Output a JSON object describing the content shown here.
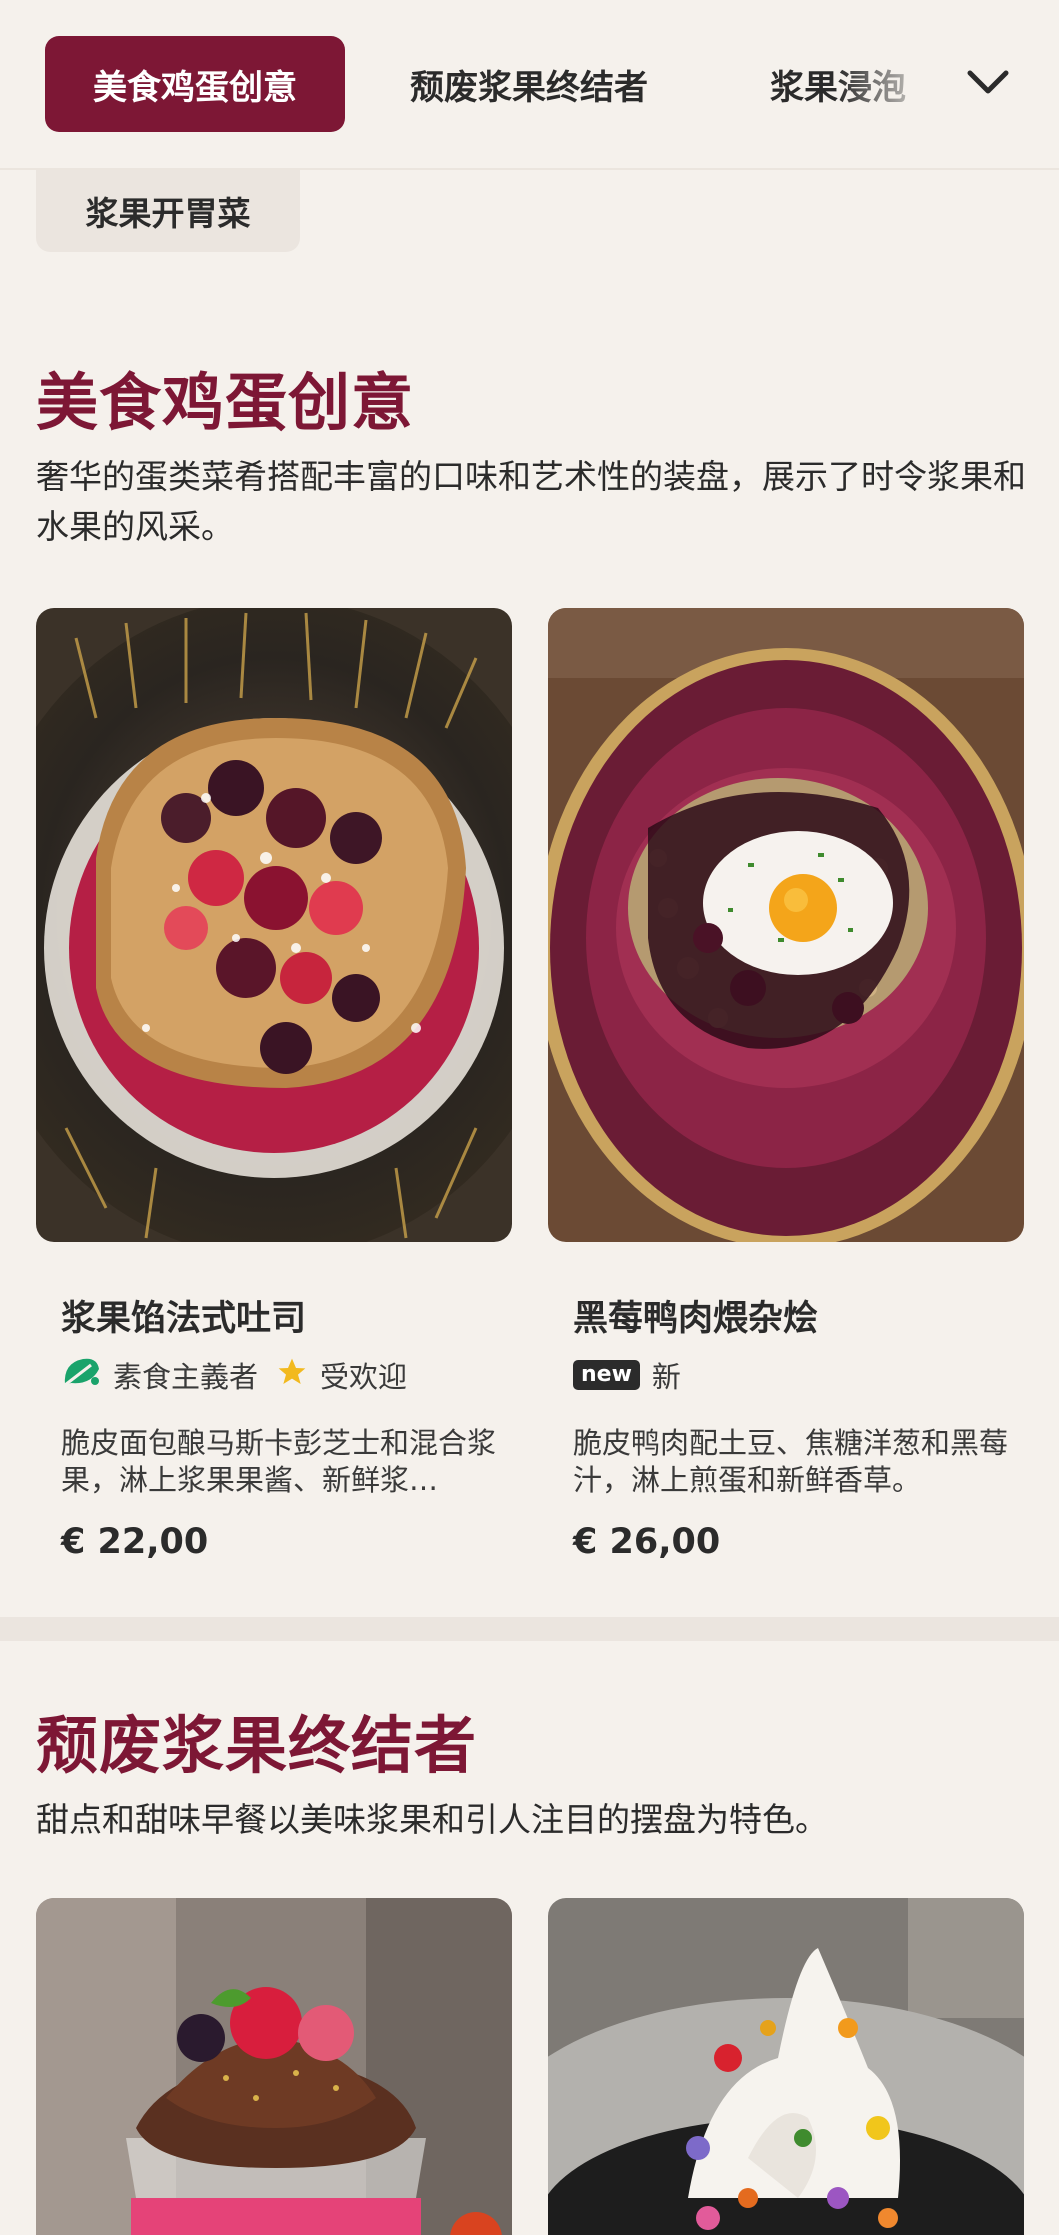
{
  "nav": {
    "tabs": [
      {
        "label": "美食鸡蛋创意",
        "active": true
      },
      {
        "label": "颓废浆果终结者"
      },
      {
        "label": "浆果浸泡"
      },
      {
        "label": "浆果开胃菜"
      }
    ],
    "more_icon": "chevron-down-icon"
  },
  "sections": [
    {
      "title": "美食鸡蛋创意",
      "description": "奢华的蛋类菜肴搭配丰富的口味和艺术性的装盘，展示了时令浆果和水果的风采。",
      "items": [
        {
          "name": "浆果馅法式吐司",
          "tags": [
            {
              "icon": "vegetarian-leaf-icon",
              "label": "素食主義者"
            },
            {
              "icon": "star-icon",
              "label": "受欢迎"
            }
          ],
          "description": "脆皮面包酿马斯卡彭芝士和混合浆果，淋上浆果果酱、新鲜浆…",
          "price": "€ 22,00"
        },
        {
          "name": "黑莓鸭肉煨杂烩",
          "tags": [
            {
              "icon": "new-badge",
              "badge": "new",
              "label": "新"
            }
          ],
          "description": "脆皮鸭肉配土豆、焦糖洋葱和黑莓汁，淋上煎蛋和新鲜香草。",
          "price": "€ 26,00"
        }
      ]
    },
    {
      "title": "颓废浆果终结者",
      "description": "甜点和甜味早餐以美味浆果和引人注目的摆盘为特色。"
    }
  ],
  "colors": {
    "accent": "#7d1735",
    "background": "#f5f1ec",
    "tab_inactive_bg": "#ebe5df",
    "vegetarian_green": "#1aa36b",
    "star_yellow": "#f2b91e"
  }
}
